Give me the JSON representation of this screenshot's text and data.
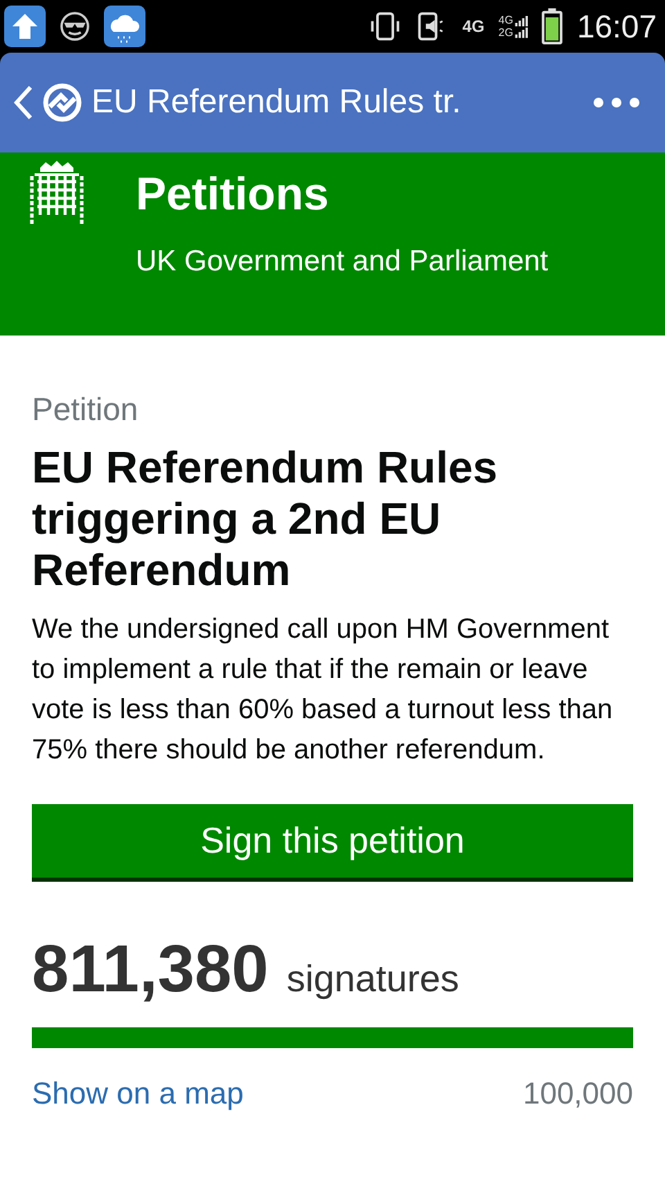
{
  "status_bar": {
    "network": "4G",
    "signal_labels": [
      "4G",
      "2G"
    ],
    "time": "16:07"
  },
  "app_bar": {
    "title": "EU Referendum Rules tr."
  },
  "header": {
    "title": "Petitions",
    "subtitle": "UK Government and Parliament"
  },
  "petition": {
    "label": "Petition",
    "title": "EU Referendum Rules triggering a 2nd EU Referendum",
    "description": "We the undersigned call upon HM Government to implement a rule that if the remain or leave vote is less than 60% based a turnout less than 75% there should be another referendum.",
    "sign_button": "Sign this petition",
    "count": "811,380",
    "count_unit": "signatures",
    "progress": {
      "level": 1
    },
    "map_link": "Show on a map",
    "threshold": "100,000"
  }
}
